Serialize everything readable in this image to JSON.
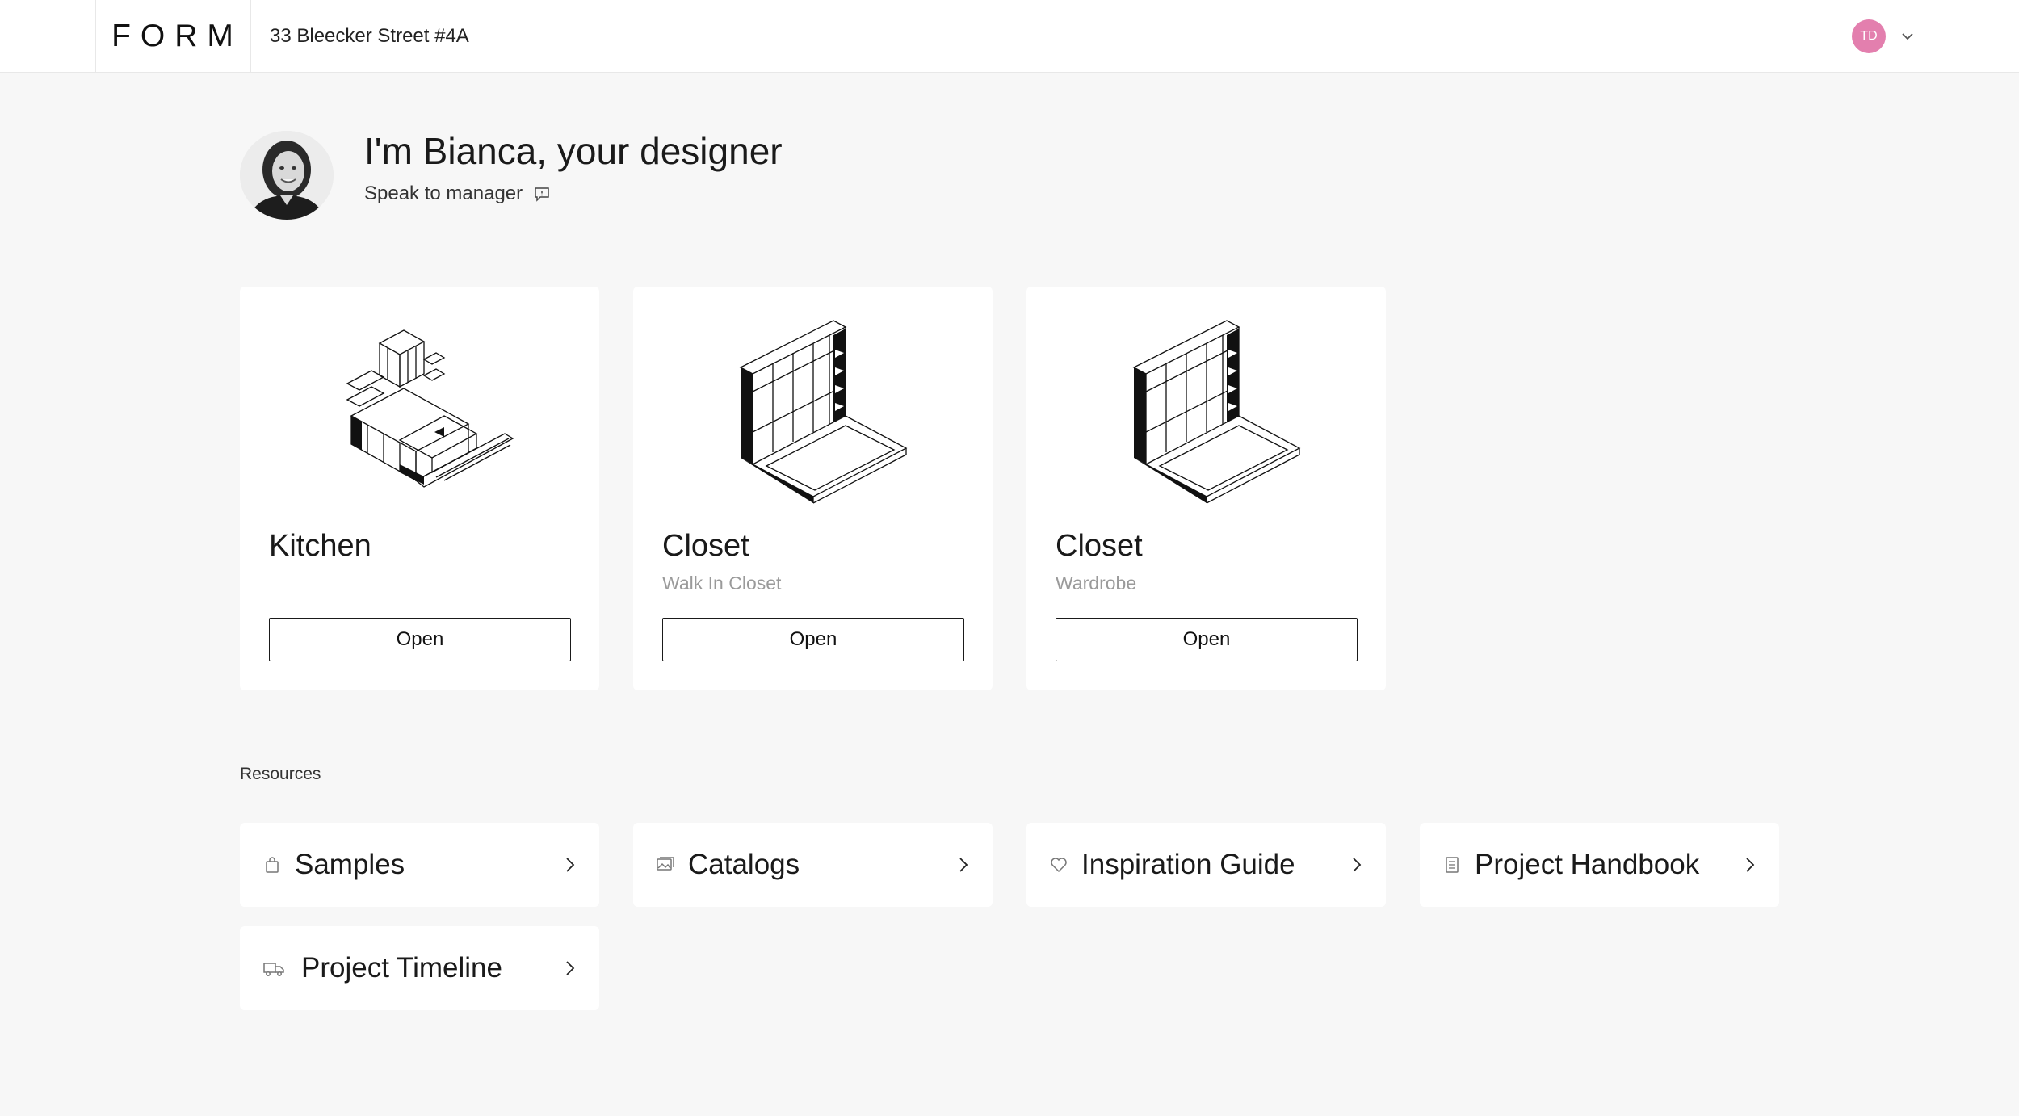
{
  "header": {
    "logo": "FORM",
    "address": "33 Bleecker Street #4A",
    "user_initials": "TD",
    "accent_color": "#e37fae"
  },
  "designer": {
    "title": "I'm Bianca, your designer",
    "link_label": "Speak to manager"
  },
  "projects": [
    {
      "title": "Kitchen",
      "subtitle": "",
      "button": "Open",
      "icon": "kitchen-illustration"
    },
    {
      "title": "Closet",
      "subtitle": "Walk In Closet",
      "button": "Open",
      "icon": "closet-illustration"
    },
    {
      "title": "Closet",
      "subtitle": "Wardrobe",
      "button": "Open",
      "icon": "closet-illustration"
    }
  ],
  "resources": {
    "label": "Resources",
    "items": [
      {
        "label": "Samples",
        "icon": "bag-icon"
      },
      {
        "label": "Catalogs",
        "icon": "images-icon"
      },
      {
        "label": "Inspiration Guide",
        "icon": "heart-icon"
      },
      {
        "label": "Project Handbook",
        "icon": "document-icon"
      },
      {
        "label": "Project Timeline",
        "icon": "truck-icon"
      }
    ]
  }
}
